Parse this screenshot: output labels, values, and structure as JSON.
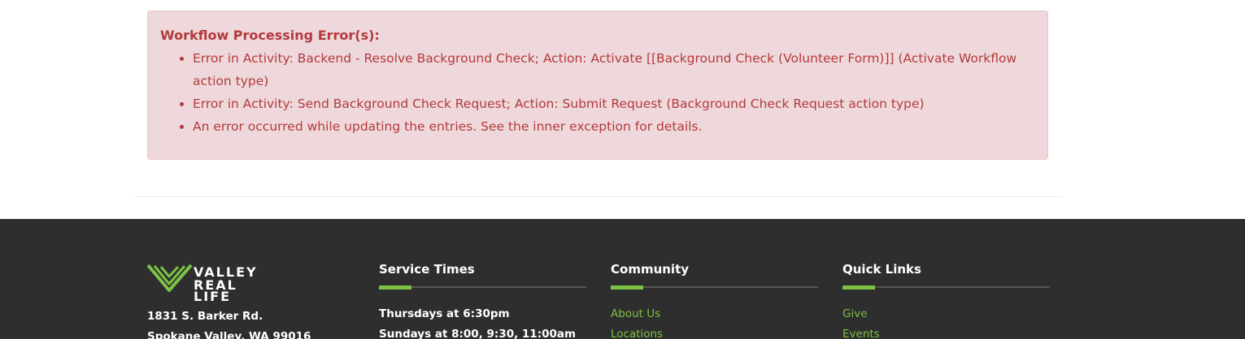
{
  "alert": {
    "title": "Workflow Processing Error(s):",
    "errors": [
      "Error in Activity: Backend - Resolve Background Check; Action: Activate [[Background Check (Volunteer Form)]] (Activate Workflow action type)",
      "Error in Activity: Send Background Check Request; Action: Submit Request (Background Check Request action type)",
      "An error occurred while updating the entries. See the inner exception for details."
    ]
  },
  "footer": {
    "logo": {
      "line1": "VALLEY",
      "line2": "REAL LIFE",
      "icon": "valley-real-life-logo-mark"
    },
    "address": {
      "street": "1831 S. Barker Rd.",
      "city": "Spokane Valley, WA 99016"
    },
    "service_times": {
      "heading": "Service Times",
      "items": [
        "Thursdays at 6:30pm",
        "Sundays at 8:00, 9:30, 11:00am"
      ]
    },
    "community": {
      "heading": "Community",
      "items": [
        "About Us",
        "Locations"
      ]
    },
    "quick_links": {
      "heading": "Quick Links",
      "items": [
        "Give",
        "Events"
      ]
    }
  },
  "colors": {
    "alert_background": "#efd8db",
    "alert_text": "#b33a3c",
    "footer_background": "#2e2e2e",
    "accent_green": "#7cc143"
  }
}
